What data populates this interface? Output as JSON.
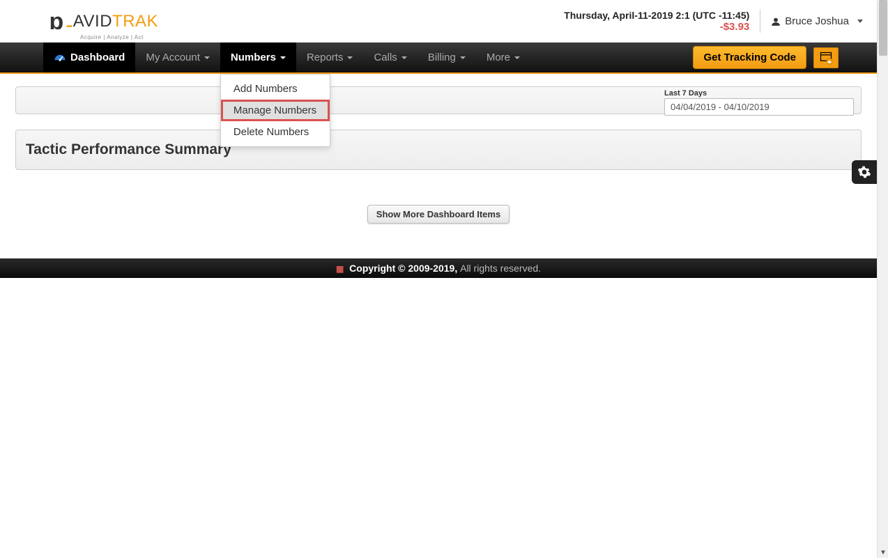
{
  "header": {
    "logo_avid": "AVID",
    "logo_trak": "TRAK",
    "logo_sub": "Acquire  |  Analyze  |  Act",
    "datetime": "Thursday, April-11-2019 2:1 (UTC -11:45)",
    "balance": "-$3.93",
    "user_name": "Bruce Joshua"
  },
  "nav": {
    "dashboard": "Dashboard",
    "my_account": "My Account",
    "numbers": "Numbers",
    "reports": "Reports",
    "calls": "Calls",
    "billing": "Billing",
    "more": "More",
    "tracking_code": "Get Tracking Code",
    "dropdown": {
      "add": "Add Numbers",
      "manage": "Manage Numbers",
      "delete": "Delete Numbers"
    }
  },
  "filter": {
    "label": "Last 7 Days",
    "range": "04/04/2019 - 04/10/2019"
  },
  "summary": {
    "title": "Tactic Performance Summary"
  },
  "show_more": "Show More Dashboard Items",
  "footer": {
    "copyright": "Copyright © 2009-2019,",
    "rights": " All rights reserved."
  }
}
